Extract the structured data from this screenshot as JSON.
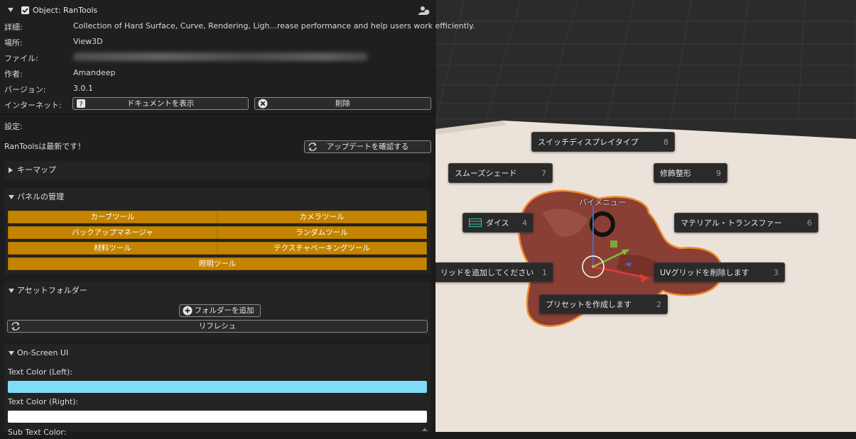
{
  "addon": {
    "title": "Object: RanTools",
    "rows": [
      {
        "label": "詳細:",
        "value": "Collection of Hard Surface, Curve, Rendering, Ligh...rease performance and help users work efficiently."
      },
      {
        "label": "場所:",
        "value": "View3D"
      },
      {
        "label": "ファイル:",
        "value": ""
      },
      {
        "label": "作者:",
        "value": "Amandeep"
      },
      {
        "label": "バージョン:",
        "value": "3.0.1"
      }
    ],
    "internet_label": "インターネット:",
    "doc_button": "ドキュメントを表示",
    "remove_button": "削除"
  },
  "settings": {
    "label": "設定:",
    "status": "RanToolsは最新です！",
    "update_button": "アップデートを確認する"
  },
  "keymap": {
    "title": "キーマップ"
  },
  "panel_mgmt": {
    "title": "パネルの管理",
    "buttons": [
      "カーブツール",
      "カメラツール",
      "バックアップマネージャ",
      "ランダムツール",
      "材料ツール",
      "テクスチャベーキングツール",
      "照明ツール"
    ]
  },
  "asset_folder": {
    "title": "アセットフォルダー",
    "add_button": "フォルダーを追加",
    "refresh_button": "リフレシュ"
  },
  "onscreen": {
    "title": "On-Screen UI",
    "left_label": "Text Color (Left):",
    "right_label": "Text Color (Right):",
    "sub_label": "Sub Text Color:",
    "left_color": "#7fdcf7",
    "right_color": "#ffffff"
  },
  "pie": {
    "title": "パイメニュー",
    "items": [
      {
        "label": "スイッチディスプレイタイプ",
        "num": "8"
      },
      {
        "label": "スムーズシェード",
        "num": "7"
      },
      {
        "label": "修飾整形",
        "num": "9"
      },
      {
        "label": "ダイス",
        "num": "4"
      },
      {
        "label": "マテリアル・トランスファー",
        "num": "6"
      },
      {
        "label": "リッドを追加してください",
        "num": "1"
      },
      {
        "label": "UVグリッドを削除します",
        "num": "3"
      },
      {
        "label": "プリセットを作成します",
        "num": "2"
      }
    ]
  },
  "colors": {
    "accent_orange": "#c58400",
    "panel_bg": "#1d1d1d",
    "viewport_floor": "#ebe3d9"
  }
}
